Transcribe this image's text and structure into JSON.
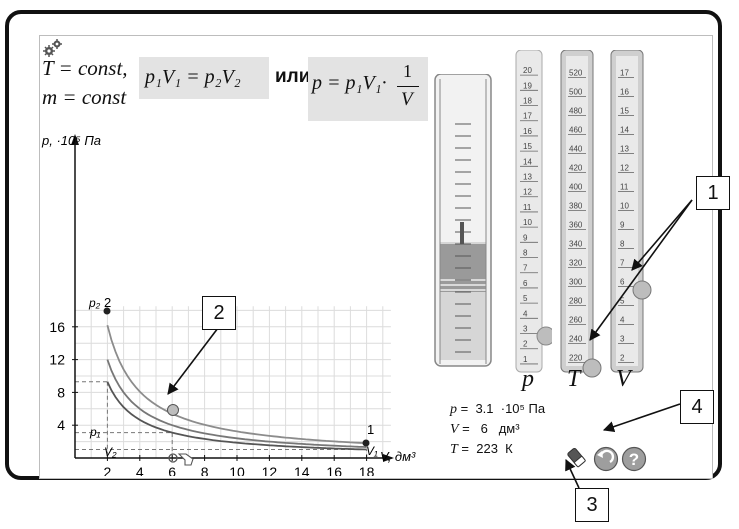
{
  "formula": {
    "line1": "T = const,",
    "line2": "m = const",
    "eq1": "p₁V₁ = p₂V₂",
    "or_word": "или",
    "eq2_left": "p = p₁V₁·",
    "eq2_num": "1",
    "eq2_den": "V"
  },
  "graph": {
    "y_axis_label": "p, ·10⁵ Па",
    "x_axis_label": "V, дм³",
    "y_ticks": [
      "4",
      "8",
      "12",
      "16"
    ],
    "x_ticks": [
      "2",
      "4",
      "6",
      "8",
      "10",
      "12",
      "14",
      "16",
      "18"
    ],
    "label_p2": "p₂",
    "label_p1": "p₁",
    "label_v2": "V₂",
    "label_v1": "V₁",
    "point_label_2": "2",
    "point_label_1": "1"
  },
  "scales": {
    "p": {
      "symbol": "p",
      "ticks": [
        "20",
        "19",
        "18",
        "17",
        "16",
        "15",
        "14",
        "13",
        "12",
        "11",
        "10",
        "9",
        "8",
        "7",
        "6",
        "5",
        "4",
        "3",
        "2",
        "1"
      ],
      "level": 3.1
    },
    "T": {
      "symbol": "T",
      "ticks": [
        "520",
        "500",
        "480",
        "460",
        "440",
        "420",
        "400",
        "380",
        "360",
        "340",
        "320",
        "300",
        "280",
        "260",
        "240",
        "220"
      ],
      "level": 223
    },
    "V": {
      "symbol": "V",
      "ticks": [
        "17",
        "16",
        "15",
        "14",
        "13",
        "12",
        "11",
        "10",
        "9",
        "8",
        "7",
        "6",
        "5",
        "4",
        "3",
        "2"
      ],
      "level": 6
    }
  },
  "readouts": {
    "p_name": "p",
    "p_value": "3.1",
    "p_unit": "·10⁵ Па",
    "v_name": "V",
    "v_value": "6",
    "v_unit": "дм³",
    "t_name": "T",
    "t_value": "223",
    "t_unit": "К"
  },
  "callouts": {
    "c1": "1",
    "c2": "2",
    "c3": "3",
    "c4": "4"
  },
  "controls": {
    "reset_icon": "eraser-icon",
    "back_icon": "undo-icon",
    "help_icon": "help-icon",
    "help_glyph": "?",
    "settings_icon": "gears-icon"
  },
  "colors": {
    "accent_gray": "#e3e3e3",
    "curve": "#666666",
    "point": "#222222"
  }
}
